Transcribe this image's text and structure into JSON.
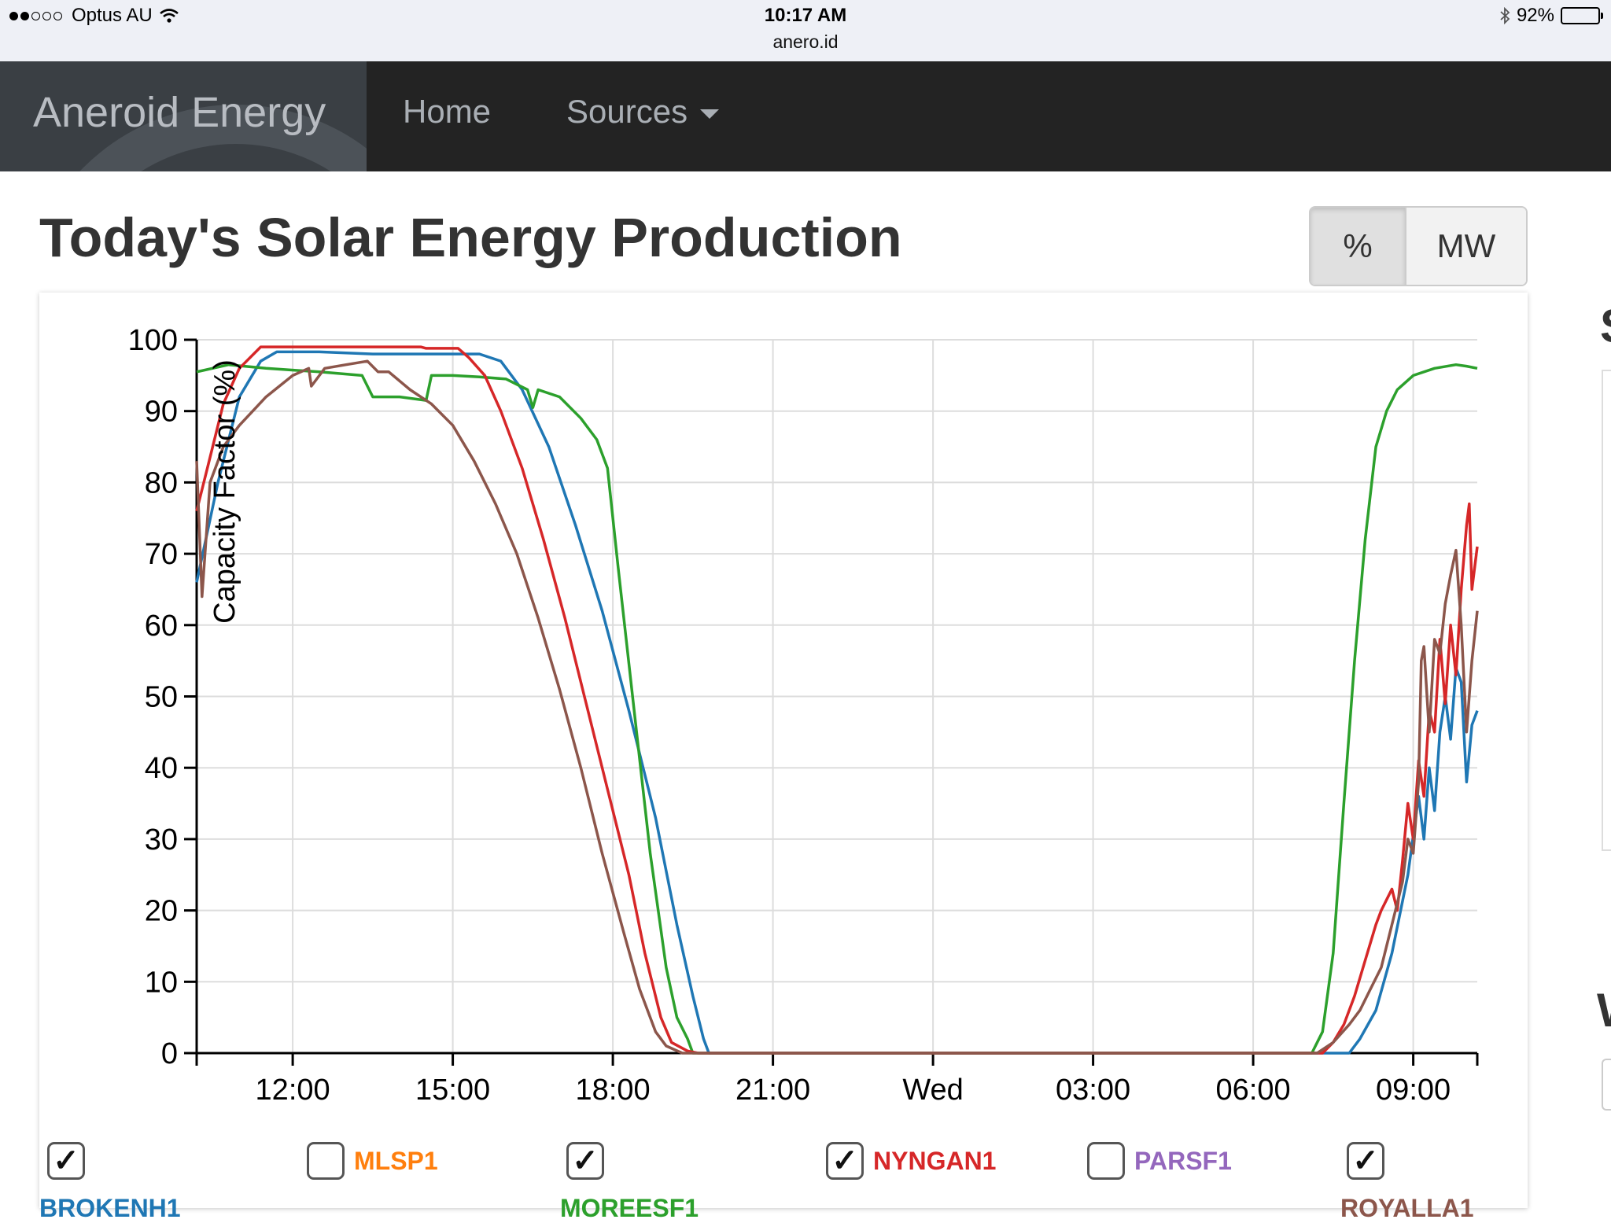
{
  "status_bar": {
    "carrier": "Optus AU",
    "time": "10:17 AM",
    "url": "anero.id",
    "battery": "92%",
    "battery_level": 0.92,
    "signal_bars_on": 2,
    "signal_bars_total": 5
  },
  "navbar": {
    "brand": "Aneroid Energy",
    "home": "Home",
    "sources": "Sources"
  },
  "page": {
    "title": "Today's Solar Energy Production",
    "units_toggle": {
      "percent": "%",
      "mw": "MW",
      "active": "percent"
    }
  },
  "chart_data": {
    "type": "line",
    "ylabel": "Capacity Factor (%)",
    "ylim": [
      0,
      100
    ],
    "yticks": [
      0,
      10,
      20,
      30,
      40,
      50,
      60,
      70,
      80,
      90,
      100
    ],
    "x_unit": "hours since 00:00 of day 1",
    "xlim": [
      10.2,
      34.2
    ],
    "xticks": [
      {
        "value": 12,
        "label": "12:00"
      },
      {
        "value": 15,
        "label": "15:00"
      },
      {
        "value": 18,
        "label": "18:00"
      },
      {
        "value": 21,
        "label": "21:00"
      },
      {
        "value": 24,
        "label": "Wed"
      },
      {
        "value": 27,
        "label": "03:00"
      },
      {
        "value": 30,
        "label": "06:00"
      },
      {
        "value": 33,
        "label": "09:00"
      }
    ],
    "grid": true,
    "series": [
      {
        "name": "BROKENH1",
        "color": "#1f77b4",
        "points": [
          [
            10.2,
            66
          ],
          [
            10.6,
            80
          ],
          [
            11.0,
            92
          ],
          [
            11.4,
            97
          ],
          [
            11.7,
            98.3
          ],
          [
            12.5,
            98.3
          ],
          [
            13.5,
            98
          ],
          [
            14.5,
            98
          ],
          [
            15.5,
            98
          ],
          [
            15.9,
            97
          ],
          [
            16.3,
            93
          ],
          [
            16.8,
            85
          ],
          [
            17.3,
            74
          ],
          [
            17.8,
            62
          ],
          [
            18.3,
            48
          ],
          [
            18.8,
            33
          ],
          [
            19.2,
            18
          ],
          [
            19.5,
            8
          ],
          [
            19.7,
            2
          ],
          [
            19.8,
            0
          ],
          [
            31.8,
            0
          ],
          [
            32.0,
            2
          ],
          [
            32.3,
            6
          ],
          [
            32.6,
            14
          ],
          [
            32.9,
            25
          ],
          [
            33.1,
            36
          ],
          [
            33.2,
            30
          ],
          [
            33.3,
            40
          ],
          [
            33.4,
            34
          ],
          [
            33.5,
            45
          ],
          [
            33.6,
            50
          ],
          [
            33.7,
            44
          ],
          [
            33.8,
            54
          ],
          [
            33.9,
            52
          ],
          [
            34.0,
            38
          ],
          [
            34.1,
            46
          ],
          [
            34.2,
            48
          ]
        ]
      },
      {
        "name": "MOREESF1",
        "color": "#2ca02c",
        "points": [
          [
            10.2,
            95.5
          ],
          [
            10.8,
            96.5
          ],
          [
            11.5,
            96
          ],
          [
            12.5,
            95.5
          ],
          [
            13.3,
            95
          ],
          [
            13.5,
            92
          ],
          [
            14.0,
            92
          ],
          [
            14.5,
            91.5
          ],
          [
            14.6,
            95
          ],
          [
            15.0,
            95
          ],
          [
            15.5,
            94.8
          ],
          [
            16.0,
            94.5
          ],
          [
            16.4,
            93
          ],
          [
            16.5,
            90.5
          ],
          [
            16.6,
            93
          ],
          [
            17.0,
            92
          ],
          [
            17.4,
            89
          ],
          [
            17.7,
            86
          ],
          [
            17.9,
            82
          ],
          [
            18.1,
            68
          ],
          [
            18.4,
            48
          ],
          [
            18.7,
            28
          ],
          [
            19.0,
            12
          ],
          [
            19.2,
            5
          ],
          [
            19.4,
            2
          ],
          [
            19.5,
            0
          ],
          [
            31.1,
            0
          ],
          [
            31.3,
            3
          ],
          [
            31.5,
            14
          ],
          [
            31.7,
            35
          ],
          [
            31.9,
            55
          ],
          [
            32.1,
            72
          ],
          [
            32.3,
            85
          ],
          [
            32.5,
            90
          ],
          [
            32.7,
            93
          ],
          [
            33.0,
            95
          ],
          [
            33.4,
            96
          ],
          [
            33.8,
            96.5
          ],
          [
            34.0,
            96.3
          ],
          [
            34.2,
            96
          ]
        ]
      },
      {
        "name": "NYNGAN1",
        "color": "#d62728",
        "points": [
          [
            10.2,
            76
          ],
          [
            10.4,
            82
          ],
          [
            10.7,
            91
          ],
          [
            11.0,
            96
          ],
          [
            11.4,
            99
          ],
          [
            12.5,
            99
          ],
          [
            13.5,
            99
          ],
          [
            14.4,
            99
          ],
          [
            14.5,
            98.8
          ],
          [
            15.1,
            98.8
          ],
          [
            15.3,
            97.5
          ],
          [
            15.6,
            95
          ],
          [
            15.9,
            90
          ],
          [
            16.3,
            82
          ],
          [
            16.7,
            72
          ],
          [
            17.1,
            61
          ],
          [
            17.5,
            49
          ],
          [
            17.9,
            37
          ],
          [
            18.3,
            25
          ],
          [
            18.6,
            14
          ],
          [
            18.9,
            5
          ],
          [
            19.1,
            1.5
          ],
          [
            19.4,
            0.3
          ],
          [
            19.6,
            0
          ],
          [
            31.3,
            0
          ],
          [
            31.5,
            1.5
          ],
          [
            31.7,
            4
          ],
          [
            31.9,
            8
          ],
          [
            32.1,
            13
          ],
          [
            32.3,
            18
          ],
          [
            32.4,
            20
          ],
          [
            32.6,
            23
          ],
          [
            32.7,
            20
          ],
          [
            32.8,
            27
          ],
          [
            32.9,
            35
          ],
          [
            33.0,
            30
          ],
          [
            33.1,
            41
          ],
          [
            33.2,
            36
          ],
          [
            33.3,
            48
          ],
          [
            33.4,
            45
          ],
          [
            33.5,
            58
          ],
          [
            33.6,
            49
          ],
          [
            33.7,
            60
          ],
          [
            33.8,
            53
          ],
          [
            33.9,
            65
          ],
          [
            34.0,
            74
          ],
          [
            34.05,
            77
          ],
          [
            34.1,
            65
          ],
          [
            34.2,
            71
          ]
        ]
      },
      {
        "name": "ROYALLA1",
        "color": "#8c564b",
        "points": [
          [
            10.2,
            83
          ],
          [
            10.3,
            64
          ],
          [
            10.45,
            80
          ],
          [
            10.7,
            85
          ],
          [
            11.0,
            88
          ],
          [
            11.5,
            92
          ],
          [
            12.0,
            95
          ],
          [
            12.3,
            96
          ],
          [
            12.35,
            93.5
          ],
          [
            12.6,
            96
          ],
          [
            13.0,
            96.5
          ],
          [
            13.4,
            97
          ],
          [
            13.6,
            95.5
          ],
          [
            13.8,
            95.5
          ],
          [
            14.2,
            93
          ],
          [
            14.6,
            91
          ],
          [
            15.0,
            88
          ],
          [
            15.4,
            83
          ],
          [
            15.8,
            77
          ],
          [
            16.2,
            70
          ],
          [
            16.6,
            61
          ],
          [
            17.0,
            51
          ],
          [
            17.4,
            40
          ],
          [
            17.8,
            28
          ],
          [
            18.2,
            17
          ],
          [
            18.5,
            9
          ],
          [
            18.8,
            3
          ],
          [
            19.0,
            1
          ],
          [
            19.3,
            0
          ],
          [
            31.2,
            0
          ],
          [
            31.5,
            1.5
          ],
          [
            31.8,
            4
          ],
          [
            32.0,
            6
          ],
          [
            32.2,
            9
          ],
          [
            32.4,
            12
          ],
          [
            32.6,
            18
          ],
          [
            32.8,
            24
          ],
          [
            32.9,
            30
          ],
          [
            33.0,
            28
          ],
          [
            33.1,
            38
          ],
          [
            33.15,
            55
          ],
          [
            33.2,
            57
          ],
          [
            33.3,
            45
          ],
          [
            33.4,
            58
          ],
          [
            33.5,
            56
          ],
          [
            33.6,
            63
          ],
          [
            33.7,
            67
          ],
          [
            33.8,
            70.5
          ],
          [
            33.9,
            60
          ],
          [
            34.0,
            45
          ],
          [
            34.1,
            55
          ],
          [
            34.2,
            62
          ]
        ]
      }
    ]
  },
  "legend": {
    "items": [
      {
        "name": "BROKENH1",
        "checked": true,
        "color": "#1f77b4"
      },
      {
        "name": "MLSP1",
        "checked": false,
        "color": "#ff7f0e"
      },
      {
        "name": "MOREESF1",
        "checked": true,
        "color": "#2ca02c"
      },
      {
        "name": "NYNGAN1",
        "checked": true,
        "color": "#d62728"
      },
      {
        "name": "PARSF1",
        "checked": false,
        "color": "#9467bd"
      },
      {
        "name": "ROYALLA1",
        "checked": true,
        "color": "#8c564b"
      }
    ]
  },
  "side": {
    "partial_heading_1": "S",
    "partial_heading_2": "W"
  }
}
